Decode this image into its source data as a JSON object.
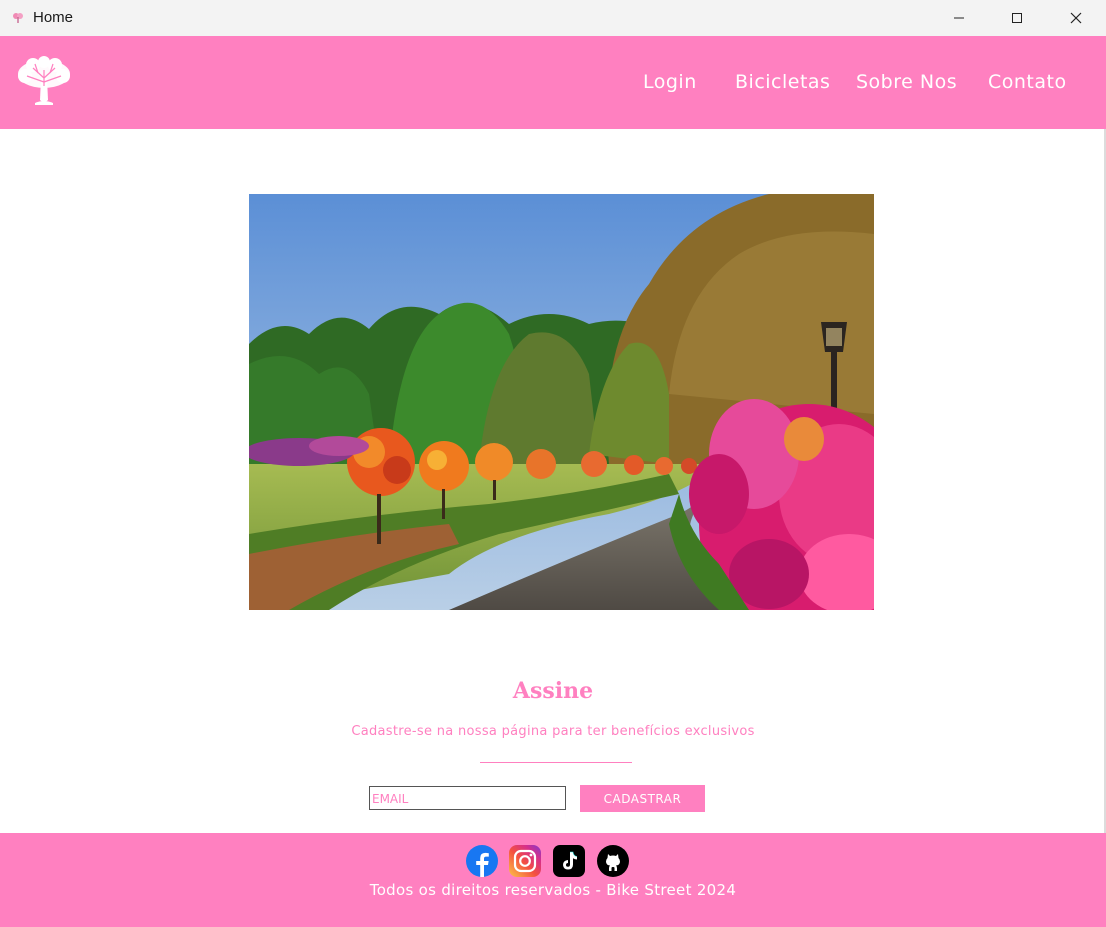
{
  "window": {
    "title": "Home"
  },
  "nav": {
    "links": [
      "Login",
      "Bicicletas",
      "Sobre Nos",
      "Contato"
    ]
  },
  "subscribe": {
    "title": "Assine",
    "text": "Cadastre-se na nossa página para ter benefícios exclusivos",
    "email_placeholder": "EMAIL",
    "button_label": "CADASTRAR"
  },
  "footer": {
    "social": [
      "facebook-icon",
      "instagram-icon",
      "tiktok-icon",
      "github-icon"
    ],
    "copyright": "Todos os direitos reservados - Bike Street 2024"
  },
  "colors": {
    "brand_pink": "#ff80c0",
    "white": "#ffffff"
  }
}
